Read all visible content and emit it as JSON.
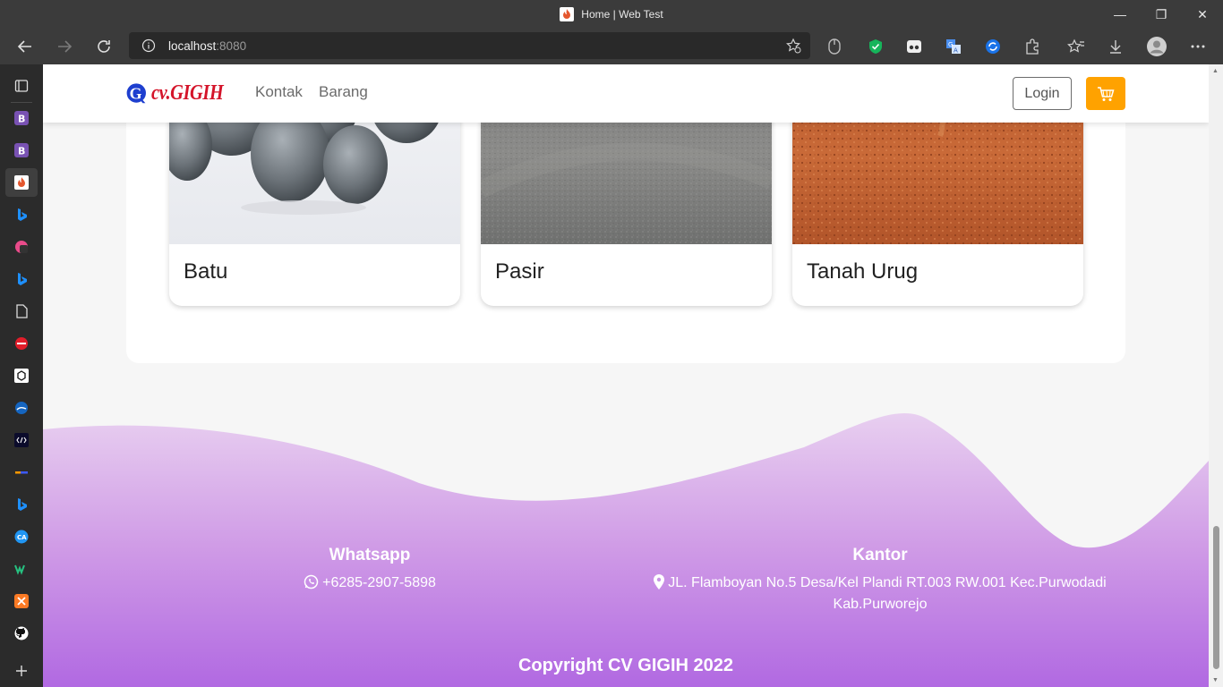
{
  "browser": {
    "tab_title": "Home | Web Test",
    "address_host": "localhost",
    "address_port": ":8080"
  },
  "site": {
    "brand": "cv.GIGIH",
    "nav": [
      "Kontak",
      "Barang"
    ],
    "login_label": "Login"
  },
  "products": [
    {
      "name": "Batu"
    },
    {
      "name": "Pasir"
    },
    {
      "name": "Tanah Urug"
    }
  ],
  "footer": {
    "whatsapp_heading": "Whatsapp",
    "whatsapp_number": "+6285-2907-5898",
    "office_heading": "Kantor",
    "office_address_line1": "JL. Flamboyan No.5 Desa/Kel Plandi RT.003 RW.001 Kec.Purwodadi",
    "office_address_line2": "Kab.Purworejo",
    "copyright": "Copyright CV GIGIH 2022"
  },
  "colors": {
    "cart_button": "#ffa200",
    "footer_gradient_top": "#e5c6ee",
    "footer_gradient_bottom": "#b169e2",
    "brand_red": "#d4142a",
    "brand_blue": "#1e3fcf"
  }
}
